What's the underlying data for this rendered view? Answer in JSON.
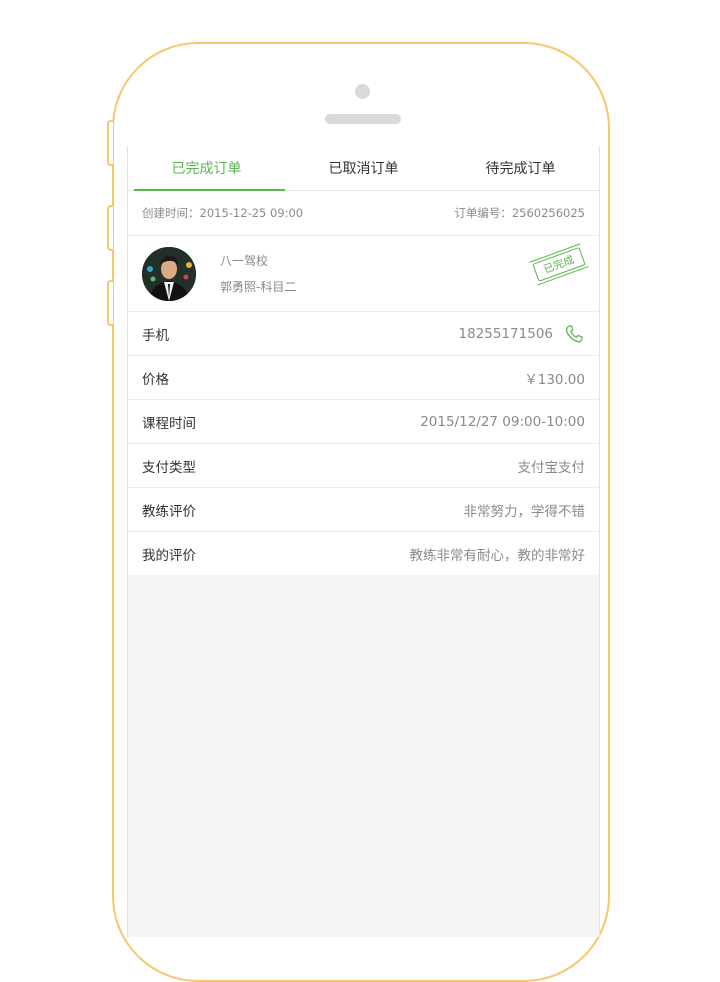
{
  "tabs": [
    {
      "label": "已完成订单",
      "active": true
    },
    {
      "label": "已取消订单",
      "active": false
    },
    {
      "label": "待完成订单",
      "active": false
    }
  ],
  "order": {
    "created": "创建时间：2015-12-25 09:00",
    "number": "订单编号：2560256025"
  },
  "coach": {
    "school": "八一驾校",
    "name_subject": "郭勇照-科目二",
    "status_stamp": "已完成"
  },
  "details": [
    {
      "label": "手机",
      "value": "18255171506"
    },
    {
      "label": "价格",
      "value": "￥130.00"
    },
    {
      "label": "课程时间",
      "value": "2015/12/27 09:00-10:00"
    },
    {
      "label": "支付类型",
      "value": "支付宝支付"
    },
    {
      "label": "教练评价",
      "value": "非常努力，学得不错"
    },
    {
      "label": "我的评价",
      "value": "教练非常有耐心，教的非常好"
    }
  ],
  "colors": {
    "accent": "#58b84b",
    "frame": "#f5c96a",
    "background": "#f4f4f4"
  },
  "icons": {
    "phone": "phone-icon"
  }
}
